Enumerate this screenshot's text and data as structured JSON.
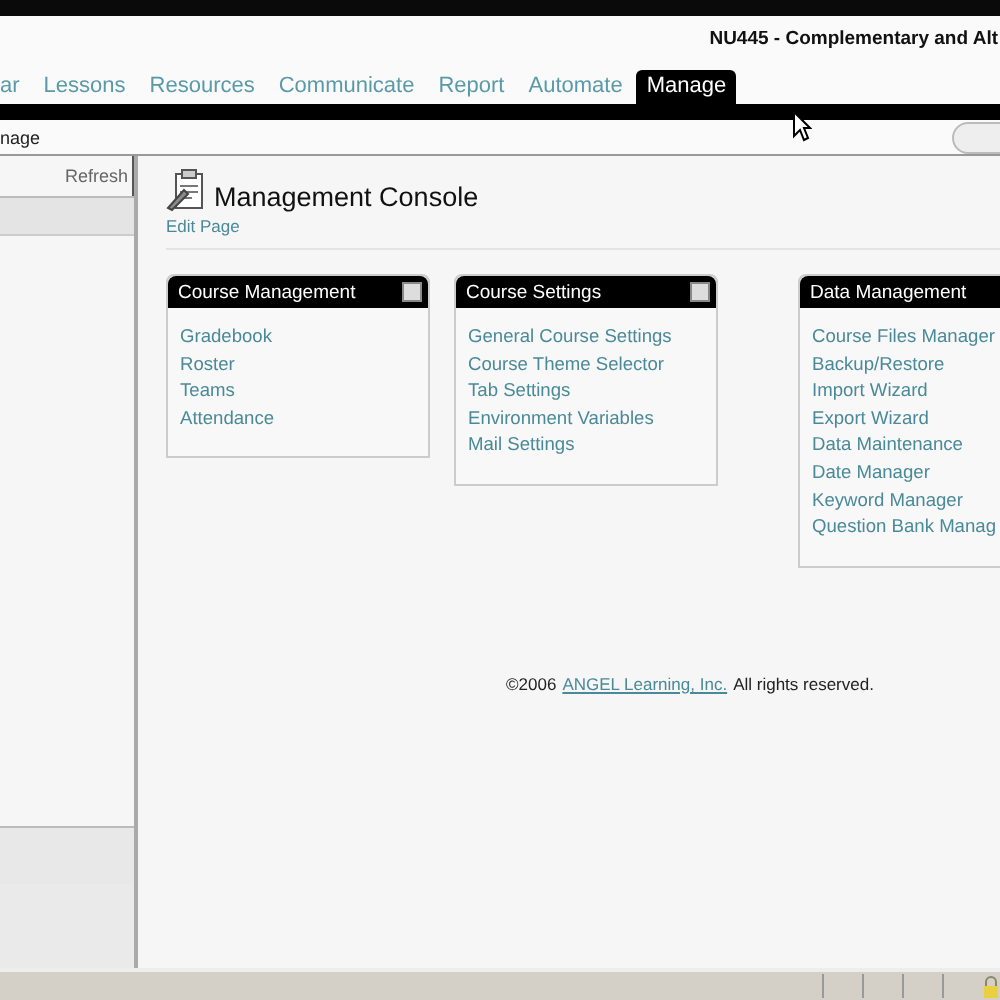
{
  "header": {
    "course_title": "NU445 - Complementary and Alt"
  },
  "tabs": [
    {
      "label": "ar",
      "selected": false
    },
    {
      "label": "Lessons",
      "selected": false
    },
    {
      "label": "Resources",
      "selected": false
    },
    {
      "label": "Communicate",
      "selected": false
    },
    {
      "label": "Report",
      "selected": false
    },
    {
      "label": "Automate",
      "selected": false
    },
    {
      "label": "Manage",
      "selected": true
    }
  ],
  "breadcrumb": "nage",
  "sidebar": {
    "refresh": "Refresh"
  },
  "page": {
    "title": "Management Console",
    "edit_link": "Edit Page"
  },
  "panels": [
    {
      "title": "Course Management",
      "collapsible": true,
      "links": [
        "Gradebook",
        "Roster",
        "Teams",
        "Attendance"
      ]
    },
    {
      "title": "Course Settings",
      "collapsible": true,
      "links": [
        "General Course Settings",
        "Course Theme Selector",
        "Tab Settings",
        "Environment Variables",
        "Mail Settings"
      ]
    },
    {
      "title": "Data Management",
      "links": [
        "Course Files Manager",
        "Backup/Restore",
        "Import Wizard",
        "Export Wizard",
        "Data Maintenance",
        "Date Manager",
        "Keyword Manager",
        "Question Bank Manag"
      ]
    }
  ],
  "footer": {
    "prefix": "©2006",
    "link": "ANGEL Learning, Inc.",
    "suffix": "All rights reserved."
  }
}
